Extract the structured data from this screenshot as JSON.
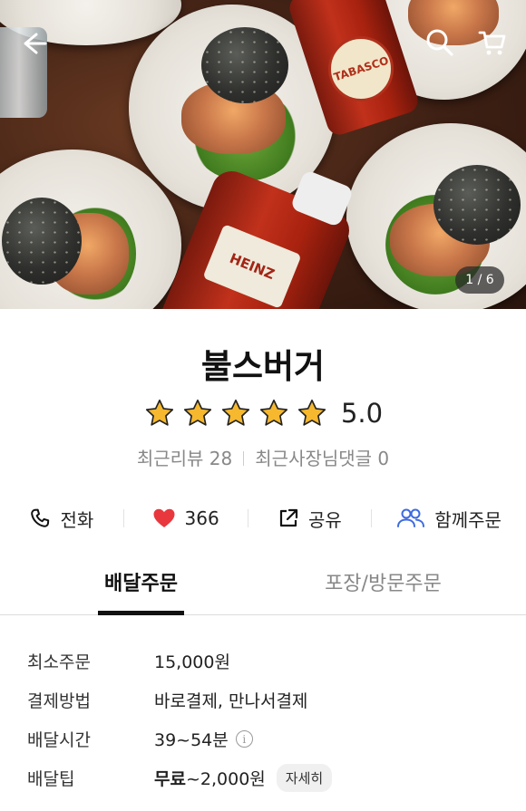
{
  "hero": {
    "counter": "1 / 6",
    "back_icon": "arrow-left-icon",
    "search_icon": "search-icon",
    "cart_icon": "cart-icon",
    "bottle1_label": "TABASCO",
    "bottle2_label": "HEINZ"
  },
  "store": {
    "name": "불스버거",
    "rating_value": "5.0",
    "stars": 5,
    "recent_reviews": "최근리뷰 28",
    "owner_comments": "최근사장님댓글 0"
  },
  "actions": {
    "call": "전화",
    "likes": "366",
    "share": "공유",
    "group_order": "함께주문"
  },
  "tabs": {
    "delivery": "배달주문",
    "takeout": "포장/방문주문"
  },
  "details": {
    "min_order_label": "최소주문",
    "min_order_value": "15,000원",
    "payment_label": "결제방법",
    "payment_value": "바로결제, 만나서결제",
    "time_label": "배달시간",
    "time_value": "39~54분",
    "tip_label": "배달팁",
    "tip_free": "무료",
    "tip_range": "~2,000원",
    "tip_detail": "자세히"
  },
  "colors": {
    "star": "#F5B82E",
    "heart": "#E8383D",
    "group_icon": "#3D6BE0"
  }
}
